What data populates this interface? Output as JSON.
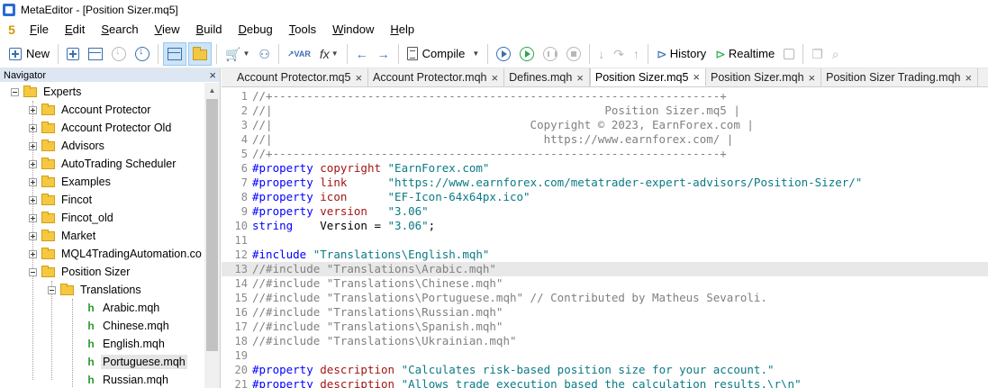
{
  "window": {
    "title": "MetaEditor - [Position Sizer.mq5]"
  },
  "menu": {
    "logo": "5",
    "items": [
      {
        "first": "F",
        "rest": "ile"
      },
      {
        "first": "E",
        "rest": "dit"
      },
      {
        "first": "S",
        "rest": "earch"
      },
      {
        "first": "V",
        "rest": "iew"
      },
      {
        "first": "B",
        "rest": "uild"
      },
      {
        "first": "D",
        "rest": "ebug"
      },
      {
        "first": "T",
        "rest": "ools"
      },
      {
        "first": "W",
        "rest": "indow"
      },
      {
        "first": "H",
        "rest": "elp"
      }
    ]
  },
  "toolbar": {
    "new_label": "New",
    "var_label": "VAR",
    "fx_label": "fx",
    "compile_label": "Compile",
    "history_label": "History",
    "realtime_label": "Realtime"
  },
  "navigator": {
    "title": "Navigator",
    "items": [
      {
        "label": "Experts"
      },
      {
        "label": "Account Protector"
      },
      {
        "label": "Account Protector Old"
      },
      {
        "label": "Advisors"
      },
      {
        "label": "AutoTrading Scheduler"
      },
      {
        "label": "Examples"
      },
      {
        "label": "Fincot"
      },
      {
        "label": "Fincot_old"
      },
      {
        "label": "Market"
      },
      {
        "label": "MQL4TradingAutomation.co"
      },
      {
        "label": "Position Sizer"
      },
      {
        "label": "Translations"
      },
      {
        "label": "Arabic.mqh"
      },
      {
        "label": "Chinese.mqh"
      },
      {
        "label": "English.mqh"
      },
      {
        "label": "Portuguese.mqh"
      },
      {
        "label": "Russian.mqh"
      }
    ]
  },
  "tabs": [
    {
      "label": "Account Protector.mq5"
    },
    {
      "label": "Account Protector.mqh"
    },
    {
      "label": "Defines.mqh"
    },
    {
      "label": "Position Sizer.mq5"
    },
    {
      "label": "Position Sizer.mqh"
    },
    {
      "label": "Position Sizer Trading.mqh"
    }
  ],
  "editor": {
    "lines": [
      {
        "n": "1",
        "segs": [
          {
            "c": "cm",
            "t": "//+------------------------------------------------------------------+"
          }
        ]
      },
      {
        "n": "2",
        "segs": [
          {
            "c": "cm",
            "t": "//|                                                 Position Sizer.mq5 |"
          }
        ]
      },
      {
        "n": "3",
        "segs": [
          {
            "c": "cm",
            "t": "//|                                      Copyright © 2023, EarnForex.com |"
          }
        ]
      },
      {
        "n": "4",
        "segs": [
          {
            "c": "cm",
            "t": "//|                                        https://www.earnforex.com/ |"
          }
        ]
      },
      {
        "n": "5",
        "segs": [
          {
            "c": "cm",
            "t": "//+------------------------------------------------------------------+"
          }
        ]
      },
      {
        "n": "6",
        "segs": [
          {
            "c": "kw",
            "t": "#property"
          },
          {
            "c": "plain",
            "t": " "
          },
          {
            "c": "id",
            "t": "copyright"
          },
          {
            "c": "plain",
            "t": " "
          },
          {
            "c": "str",
            "t": "\"EarnForex.com\""
          }
        ]
      },
      {
        "n": "7",
        "segs": [
          {
            "c": "kw",
            "t": "#property"
          },
          {
            "c": "plain",
            "t": " "
          },
          {
            "c": "id",
            "t": "link"
          },
          {
            "c": "plain",
            "t": "      "
          },
          {
            "c": "str",
            "t": "\"https://www.earnforex.com/metatrader-expert-advisors/Position-Sizer/\""
          }
        ]
      },
      {
        "n": "8",
        "segs": [
          {
            "c": "kw",
            "t": "#property"
          },
          {
            "c": "plain",
            "t": " "
          },
          {
            "c": "id",
            "t": "icon"
          },
          {
            "c": "plain",
            "t": "      "
          },
          {
            "c": "str",
            "t": "\"EF-Icon-64x64px.ico\""
          }
        ]
      },
      {
        "n": "9",
        "segs": [
          {
            "c": "kw",
            "t": "#property"
          },
          {
            "c": "plain",
            "t": " "
          },
          {
            "c": "id",
            "t": "version"
          },
          {
            "c": "plain",
            "t": "   "
          },
          {
            "c": "str",
            "t": "\"3.06\""
          }
        ]
      },
      {
        "n": "10",
        "segs": [
          {
            "c": "kw",
            "t": "string"
          },
          {
            "c": "plain",
            "t": "    Version = "
          },
          {
            "c": "str",
            "t": "\"3.06\""
          },
          {
            "c": "plain",
            "t": ";"
          }
        ]
      },
      {
        "n": "11",
        "segs": []
      },
      {
        "n": "12",
        "segs": [
          {
            "c": "kw",
            "t": "#include"
          },
          {
            "c": "plain",
            "t": " "
          },
          {
            "c": "str",
            "t": "\"Translations\\English.mqh\""
          }
        ]
      },
      {
        "n": "13",
        "segs": [
          {
            "c": "cm",
            "t": "//#include \"Translations\\Arabic.mqh\""
          }
        ],
        "hl": true
      },
      {
        "n": "14",
        "segs": [
          {
            "c": "cm",
            "t": "//#include \"Translations\\Chinese.mqh\""
          }
        ]
      },
      {
        "n": "15",
        "segs": [
          {
            "c": "cm",
            "t": "//#include \"Translations\\Portuguese.mqh\" // Contributed by Matheus Sevaroli."
          }
        ]
      },
      {
        "n": "16",
        "segs": [
          {
            "c": "cm",
            "t": "//#include \"Translations\\Russian.mqh\""
          }
        ]
      },
      {
        "n": "17",
        "segs": [
          {
            "c": "cm",
            "t": "//#include \"Translations\\Spanish.mqh\""
          }
        ]
      },
      {
        "n": "18",
        "segs": [
          {
            "c": "cm",
            "t": "//#include \"Translations\\Ukrainian.mqh\""
          }
        ]
      },
      {
        "n": "19",
        "segs": []
      },
      {
        "n": "20",
        "segs": [
          {
            "c": "kw",
            "t": "#property"
          },
          {
            "c": "plain",
            "t": " "
          },
          {
            "c": "id",
            "t": "description"
          },
          {
            "c": "plain",
            "t": " "
          },
          {
            "c": "str",
            "t": "\"Calculates risk-based position size for your account.\""
          }
        ]
      },
      {
        "n": "21",
        "segs": [
          {
            "c": "kw",
            "t": "#property"
          },
          {
            "c": "plain",
            "t": " "
          },
          {
            "c": "id",
            "t": "description"
          },
          {
            "c": "plain",
            "t": " "
          },
          {
            "c": "str",
            "t": "\"Allows trade execution based the calculation results.\\r\\n\""
          }
        ]
      }
    ]
  }
}
